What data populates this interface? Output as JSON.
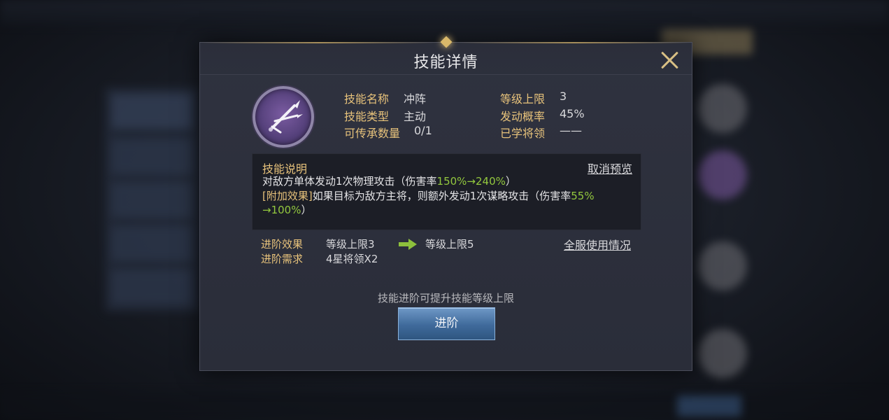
{
  "dialog": {
    "title": "技能详情"
  },
  "skill": {
    "name_label": "技能名称",
    "name_value": "冲阵",
    "type_label": "技能类型",
    "type_value": "主动",
    "inherit_label": "可传承数量",
    "inherit_value": "0/1",
    "level_cap_label": "等级上限",
    "level_cap_value": "3",
    "trigger_label": "发动概率",
    "trigger_value": "45%",
    "learned_label": "已学将领",
    "learned_value": "——"
  },
  "description": {
    "title": "技能说明",
    "cancel_preview": "取消预览",
    "line1_text": "对敌方单体发动1次物理攻击（伤害率",
    "line1_highlight": "150%→240%",
    "line1_end": "）",
    "line2_tag": "[附加效果]",
    "line2_text": "如果目标为敌方主将，则额外发动1次谋略攻击（伤害率",
    "line2_highlight": "55%",
    "line3_highlight": "→100%",
    "line3_end": "）"
  },
  "advancement": {
    "effect_label": "进阶效果",
    "effect_from": "等级上限3",
    "effect_to": "等级上限5",
    "requirement_label": "进阶需求",
    "requirement_value": "4星将领X2",
    "server_usage": "全服使用情况",
    "hint": "技能进阶可提升技能等级上限",
    "button": "进阶"
  },
  "icons": {
    "close": "close-icon",
    "skill": "crossed-swords-icon",
    "arrow": "right-arrow-icon",
    "prev": "chevron-left-icon",
    "next": "chevron-right-icon"
  },
  "colors": {
    "gold": "#e7c27b",
    "green": "#93c83e",
    "button_blue": "#3f6a9b"
  }
}
